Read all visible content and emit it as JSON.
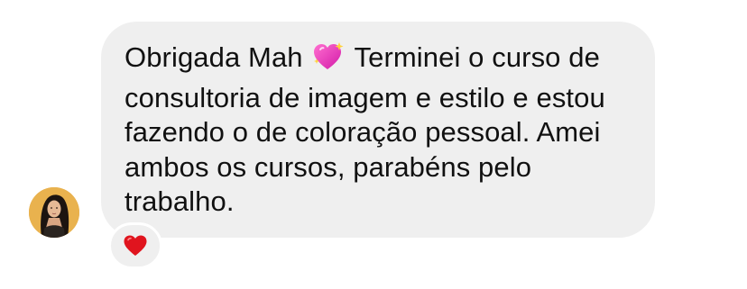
{
  "message": {
    "text_before_emoji": "Obrigada Mah ",
    "emoji_inline": "sparkling-heart-icon",
    "text_after_emoji": " Terminei o curso de consultoria de imagem e estilo e estou fazendo o de coloração pessoal. Amei ambos os cursos, parabéns pelo trabalho.",
    "bubble_color": "#efefef",
    "text_color": "#111111"
  },
  "reaction": {
    "icon": "red-heart-icon",
    "color": "#e0141e"
  },
  "avatar": {
    "icon": "user-avatar",
    "background": "#e9b24e"
  }
}
